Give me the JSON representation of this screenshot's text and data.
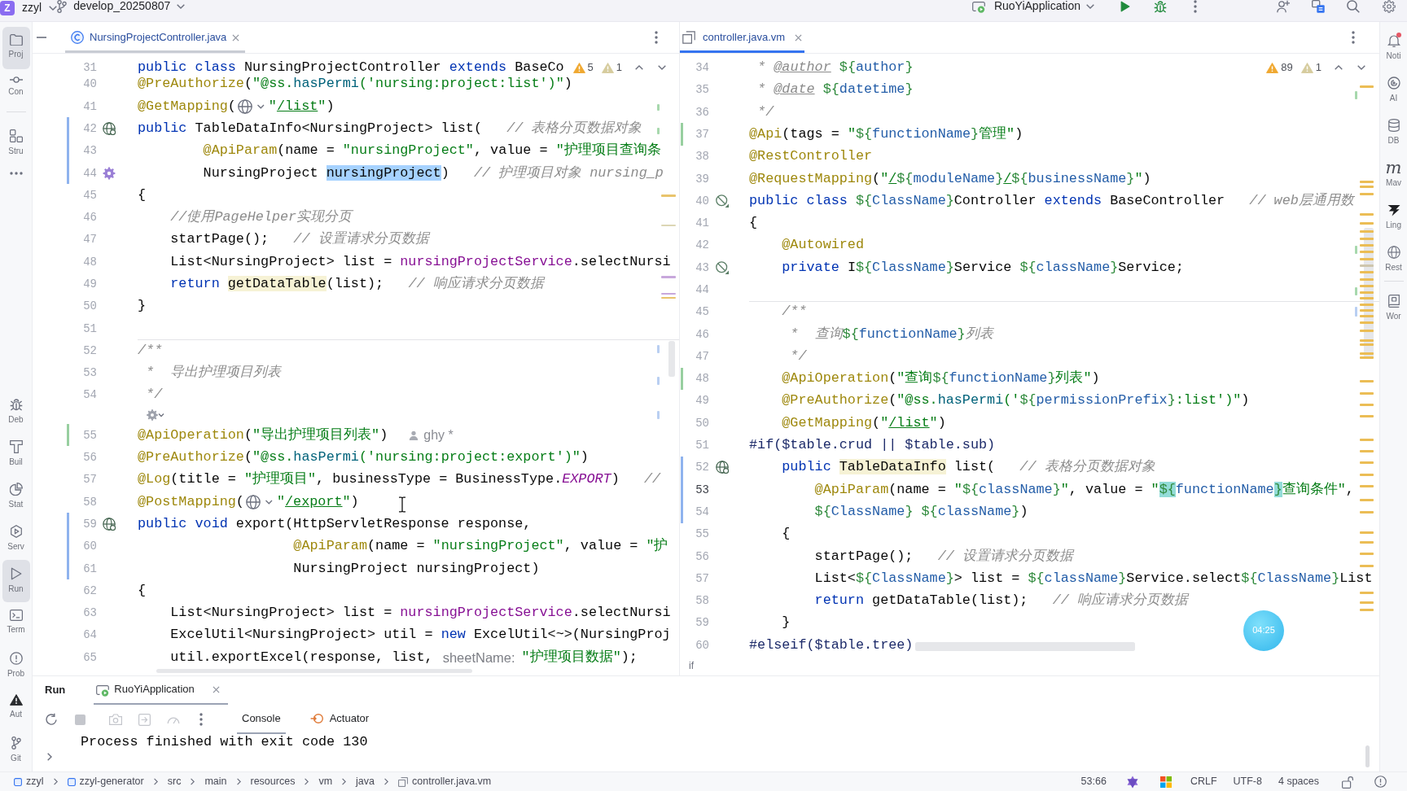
{
  "top_bar": {
    "project": {
      "initial": "Z",
      "name": "zzyl"
    },
    "branch": "develop_20250807",
    "run_configuration": "RuoYiApplication"
  },
  "left_toolbar": {
    "top_groups": [
      [
        {
          "kind": "project",
          "label": "Proj",
          "selected": true
        },
        {
          "kind": "commit",
          "label": "Con",
          "selected": false
        }
      ],
      [
        {
          "kind": "structure",
          "label": "Stru",
          "selected": false
        },
        {
          "kind": "more",
          "selected": false
        }
      ]
    ],
    "bottom": [
      {
        "kind": "debug",
        "label": "Deb",
        "selected": false
      },
      {
        "kind": "build",
        "label": "Buil",
        "selected": false
      },
      {
        "kind": "statistic",
        "label": "Stat",
        "selected": false
      },
      {
        "kind": "services",
        "label": "Serv",
        "selected": false
      },
      {
        "kind": "run",
        "label": "Run",
        "selected": true
      },
      {
        "kind": "terminal",
        "label": "Term",
        "selected": false
      },
      {
        "kind": "problems",
        "label": "Prob",
        "selected": false
      },
      {
        "kind": "alerts",
        "label": "Aut",
        "selected": false
      },
      {
        "kind": "git",
        "label": "Git",
        "selected": false
      }
    ]
  },
  "editors": [
    {
      "tab": {
        "kind": "class",
        "name": "NursingProjectController.java",
        "focused": false
      },
      "inspections": {
        "warnings": "5",
        "weak_warnings": "1"
      },
      "sticky_lines": [
        {
          "number": "31",
          "current": false,
          "tokens": [
            {
              "kind": "keyword",
              "text": "public class "
            },
            {
              "kind": "plain",
              "text": "NursingProjectController "
            },
            {
              "kind": "keyword",
              "text": "extends "
            },
            {
              "kind": "plain",
              "text": "BaseCo"
            }
          ]
        }
      ],
      "lines": [
        {
          "number": "40",
          "current": false,
          "tokens": [
            {
              "kind": "annotation",
              "text": "@PreAuthorize"
            },
            {
              "kind": "plain",
              "text": "("
            },
            {
              "kind": "string",
              "text": "\"@ss."
            },
            {
              "kind": "call",
              "text": "hasPermi"
            },
            {
              "kind": "string",
              "text": "('nursing:project:list')\""
            },
            {
              "kind": "plain",
              "text": ")"
            }
          ]
        },
        {
          "number": "41",
          "current": false,
          "tokens": [
            {
              "kind": "annotation",
              "text": "@GetMapping"
            },
            {
              "kind": "plain",
              "text": "("
            },
            {
              "kind": "endpoint"
            },
            {
              "kind": "string",
              "text": "\""
            },
            {
              "kind": "url",
              "text": "/list"
            },
            {
              "kind": "string",
              "text": "\""
            },
            {
              "kind": "plain",
              "text": ")"
            }
          ]
        },
        {
          "number": "42",
          "current": false,
          "gutter": {
            "kind": "endpoint"
          },
          "change": {
            "kind": "modified"
          },
          "tokens": [
            {
              "kind": "keyword",
              "text": "public "
            },
            {
              "kind": "plain",
              "text": "TableDataInfo<NursingProject> list(   "
            },
            {
              "kind": "comment",
              "text": "// 表格分页数据对象"
            }
          ]
        },
        {
          "number": "43",
          "current": false,
          "change": {
            "kind": "modified"
          },
          "tokens": [
            {
              "kind": "annotation",
              "text": "        @ApiParam"
            },
            {
              "kind": "plain",
              "text": "(name = "
            },
            {
              "kind": "string",
              "text": "\"nursingProject\""
            },
            {
              "kind": "plain",
              "text": ", value = "
            },
            {
              "kind": "string",
              "text": "\"护理项目查询条"
            }
          ]
        },
        {
          "number": "44",
          "current": false,
          "gutter": {
            "kind": "bean"
          },
          "change": {
            "kind": "modified"
          },
          "tokens": [
            {
              "kind": "plain",
              "text": "        NursingProject "
            },
            {
              "kind": "plain",
              "text": "nursingProject",
              "highlight": {
                "kind": "selection"
              }
            },
            {
              "kind": "plain",
              "text": ")   "
            },
            {
              "kind": "comment",
              "text": "// 护理项目对象 nursing_p"
            }
          ]
        },
        {
          "number": "45",
          "current": false,
          "tokens": [
            {
              "kind": "plain",
              "text": "{"
            }
          ]
        },
        {
          "number": "46",
          "current": false,
          "tokens": [
            {
              "kind": "comment",
              "text": "    //使用PageHelper实现分页"
            }
          ]
        },
        {
          "number": "47",
          "current": false,
          "tokens": [
            {
              "kind": "plain",
              "text": "    startPage();   "
            },
            {
              "kind": "comment",
              "text": "// 设置请求分页数据"
            }
          ]
        },
        {
          "number": "48",
          "current": false,
          "tokens": [
            {
              "kind": "plain",
              "text": "    List<NursingProject> list = "
            },
            {
              "kind": "field",
              "text": "nursingProjectService"
            },
            {
              "kind": "plain",
              "text": ".selectNursi"
            }
          ]
        },
        {
          "number": "49",
          "current": false,
          "tokens": [
            {
              "kind": "keyword",
              "text": "    return "
            },
            {
              "kind": "plain",
              "text": "getDataTable",
              "highlight": {
                "kind": "usage"
              }
            },
            {
              "kind": "plain",
              "text": "(list);   "
            },
            {
              "kind": "comment",
              "text": "// 响应请求分页数据"
            }
          ]
        },
        {
          "number": "50",
          "current": false,
          "tokens": [
            {
              "kind": "plain",
              "text": "}"
            }
          ]
        },
        {
          "number": "51",
          "current": false
        },
        {
          "number": "52",
          "current": false,
          "separator": true,
          "tokens": [
            {
              "kind": "comment",
              "text": "/**"
            }
          ]
        },
        {
          "number": "53",
          "current": false,
          "tokens": [
            {
              "kind": "comment",
              "text": " *  导出护理项目列表"
            }
          ]
        },
        {
          "number": "54",
          "current": false,
          "tokens": [
            {
              "kind": "comment",
              "text": " */"
            }
          ]
        },
        {
          "number": "55",
          "current": false,
          "change": {
            "kind": "added"
          },
          "code_vision_above": true,
          "tokens": [
            {
              "kind": "annotation",
              "text": "@ApiOperation"
            },
            {
              "kind": "plain",
              "text": "("
            },
            {
              "kind": "string",
              "text": "\"导出护理项目列表\""
            },
            {
              "kind": "plain",
              "text": ")"
            },
            {
              "kind": "author",
              "text": "ghy *"
            }
          ]
        },
        {
          "number": "56",
          "current": false,
          "tokens": [
            {
              "kind": "annotation",
              "text": "@PreAuthorize"
            },
            {
              "kind": "plain",
              "text": "("
            },
            {
              "kind": "string",
              "text": "\"@ss."
            },
            {
              "kind": "call",
              "text": "hasPermi"
            },
            {
              "kind": "string",
              "text": "('nursing:project:export')\""
            },
            {
              "kind": "plain",
              "text": ")"
            }
          ]
        },
        {
          "number": "57",
          "current": false,
          "tokens": [
            {
              "kind": "annotation",
              "text": "@Log"
            },
            {
              "kind": "plain",
              "text": "(title = "
            },
            {
              "kind": "string",
              "text": "\"护理项目\""
            },
            {
              "kind": "plain",
              "text": ", businessType = BusinessType."
            },
            {
              "kind": "constant",
              "text": "EXPORT"
            },
            {
              "kind": "plain",
              "text": ")   "
            },
            {
              "kind": "comment",
              "text": "//"
            }
          ]
        },
        {
          "number": "58",
          "current": false,
          "tokens": [
            {
              "kind": "annotation",
              "text": "@PostMapping"
            },
            {
              "kind": "plain",
              "text": "("
            },
            {
              "kind": "endpoint"
            },
            {
              "kind": "string",
              "text": "\""
            },
            {
              "kind": "url",
              "text": "/export"
            },
            {
              "kind": "string",
              "text": "\""
            },
            {
              "kind": "plain",
              "text": ")"
            }
          ]
        },
        {
          "number": "59",
          "current": false,
          "gutter": {
            "kind": "endpoint"
          },
          "change": {
            "kind": "modified"
          },
          "tokens": [
            {
              "kind": "keyword",
              "text": "public void "
            },
            {
              "kind": "plain",
              "text": "export(HttpServletResponse response,"
            }
          ]
        },
        {
          "number": "60",
          "current": false,
          "change": {
            "kind": "modified"
          },
          "tokens": [
            {
              "kind": "annotation",
              "text": "                   @ApiParam"
            },
            {
              "kind": "plain",
              "text": "(name = "
            },
            {
              "kind": "string",
              "text": "\"nursingProject\""
            },
            {
              "kind": "plain",
              "text": ", value = "
            },
            {
              "kind": "string",
              "text": "\"护"
            }
          ]
        },
        {
          "number": "61",
          "current": false,
          "change": {
            "kind": "modified"
          },
          "tokens": [
            {
              "kind": "plain",
              "text": "                   NursingProject nursingProject)"
            }
          ]
        },
        {
          "number": "62",
          "current": false,
          "tokens": [
            {
              "kind": "plain",
              "text": "{"
            }
          ]
        },
        {
          "number": "63",
          "current": false,
          "tokens": [
            {
              "kind": "plain",
              "text": "    List<NursingProject> list = "
            },
            {
              "kind": "field",
              "text": "nursingProjectService"
            },
            {
              "kind": "plain",
              "text": ".selectNursi"
            }
          ]
        },
        {
          "number": "64",
          "current": false,
          "tokens": [
            {
              "kind": "plain",
              "text": "    ExcelUtil<NursingProject> util = "
            },
            {
              "kind": "keyword",
              "text": "new "
            },
            {
              "kind": "plain",
              "text": "ExcelUtil<~>(NursingProj"
            }
          ]
        },
        {
          "number": "65",
          "current": false,
          "tokens": [
            {
              "kind": "plain",
              "text": "    util.exportExcel(response, list, "
            },
            {
              "kind": "hint",
              "text": "sheetName:"
            },
            {
              "kind": "string",
              "text": "\"护理项目数据\""
            },
            {
              "kind": "plain",
              "text": ");"
            }
          ]
        }
      ]
    },
    {
      "tab": {
        "kind": "template",
        "name": "controller.java.vm",
        "focused": true
      },
      "inspections": {
        "warnings": "89",
        "weak_warnings": "1"
      },
      "lines": [
        {
          "number": "34",
          "current": false,
          "tokens": [
            {
              "kind": "comment",
              "text": " * "
            },
            {
              "kind": "doctag",
              "text": "@author"
            },
            {
              "kind": "vardelim",
              "text": " ${"
            },
            {
              "kind": "varname",
              "text": "author"
            },
            {
              "kind": "vardelim",
              "text": "}"
            }
          ]
        },
        {
          "number": "35",
          "current": false,
          "tokens": [
            {
              "kind": "comment",
              "text": " * "
            },
            {
              "kind": "doctag",
              "text": "@date"
            },
            {
              "kind": "vardelim",
              "text": " ${"
            },
            {
              "kind": "varname",
              "text": "datetime"
            },
            {
              "kind": "vardelim",
              "text": "}"
            }
          ]
        },
        {
          "number": "36",
          "current": false,
          "tokens": [
            {
              "kind": "comment",
              "text": " */"
            }
          ]
        },
        {
          "number": "37",
          "current": false,
          "change": {
            "kind": "added"
          },
          "tokens": [
            {
              "kind": "annotation",
              "text": "@Api"
            },
            {
              "kind": "plain",
              "text": "(tags = "
            },
            {
              "kind": "string",
              "text": "\""
            },
            {
              "kind": "vardelim",
              "text": "${"
            },
            {
              "kind": "varname",
              "text": "functionName"
            },
            {
              "kind": "vardelim",
              "text": "}"
            },
            {
              "kind": "string",
              "text": "管理\""
            },
            {
              "kind": "plain",
              "text": ")"
            }
          ]
        },
        {
          "number": "38",
          "current": false,
          "tokens": [
            {
              "kind": "annotation",
              "text": "@RestController"
            }
          ]
        },
        {
          "number": "39",
          "current": false,
          "tokens": [
            {
              "kind": "annotation",
              "text": "@RequestMapping"
            },
            {
              "kind": "plain",
              "text": "("
            },
            {
              "kind": "string",
              "text": "\""
            },
            {
              "kind": "url",
              "text": "/"
            },
            {
              "kind": "vardelim",
              "text": "${"
            },
            {
              "kind": "varname",
              "text": "moduleName"
            },
            {
              "kind": "vardelim",
              "text": "}"
            },
            {
              "kind": "url",
              "text": "/"
            },
            {
              "kind": "vardelim",
              "text": "${"
            },
            {
              "kind": "varname",
              "text": "businessName"
            },
            {
              "kind": "vardelim",
              "text": "}"
            },
            {
              "kind": "string",
              "text": "\""
            },
            {
              "kind": "plain",
              "text": ")"
            }
          ]
        },
        {
          "number": "40",
          "current": false,
          "gutter": {
            "kind": "blocked"
          },
          "tokens": [
            {
              "kind": "keyword",
              "text": "public class "
            },
            {
              "kind": "vardelim",
              "text": "${"
            },
            {
              "kind": "varname",
              "text": "ClassName"
            },
            {
              "kind": "vardelim",
              "text": "}"
            },
            {
              "kind": "plain",
              "text": "Controller "
            },
            {
              "kind": "keyword",
              "text": "extends "
            },
            {
              "kind": "plain",
              "text": "BaseController   "
            },
            {
              "kind": "comment",
              "text": "// web层通用数"
            }
          ]
        },
        {
          "number": "41",
          "current": false,
          "tokens": [
            {
              "kind": "plain",
              "text": "{"
            }
          ]
        },
        {
          "number": "42",
          "current": false,
          "tokens": [
            {
              "kind": "annotation",
              "text": "    @Autowired"
            }
          ]
        },
        {
          "number": "43",
          "current": false,
          "gutter": {
            "kind": "blocked"
          },
          "tokens": [
            {
              "kind": "keyword",
              "text": "    private "
            },
            {
              "kind": "plain",
              "text": "I"
            },
            {
              "kind": "vardelim",
              "text": "${"
            },
            {
              "kind": "varname",
              "text": "ClassName"
            },
            {
              "kind": "vardelim",
              "text": "}"
            },
            {
              "kind": "plain",
              "text": "Service "
            },
            {
              "kind": "vardelim",
              "text": "${"
            },
            {
              "kind": "varname",
              "text": "className"
            },
            {
              "kind": "vardelim",
              "text": "}"
            },
            {
              "kind": "plain",
              "text": "Service;"
            }
          ]
        },
        {
          "number": "44",
          "current": false
        },
        {
          "number": "45",
          "current": false,
          "separator": true,
          "tokens": [
            {
              "kind": "comment",
              "text": "    /**"
            }
          ]
        },
        {
          "number": "46",
          "current": false,
          "tokens": [
            {
              "kind": "comment",
              "text": "     *  查询"
            },
            {
              "kind": "vardelim",
              "text": "${"
            },
            {
              "kind": "varname",
              "text": "functionName"
            },
            {
              "kind": "vardelim",
              "text": "}"
            },
            {
              "kind": "comment",
              "text": "列表"
            }
          ]
        },
        {
          "number": "47",
          "current": false,
          "tokens": [
            {
              "kind": "comment",
              "text": "     */"
            }
          ]
        },
        {
          "number": "48",
          "current": false,
          "change": {
            "kind": "added"
          },
          "tokens": [
            {
              "kind": "annotation",
              "text": "    @ApiOperation"
            },
            {
              "kind": "plain",
              "text": "("
            },
            {
              "kind": "string",
              "text": "\"查询"
            },
            {
              "kind": "vardelim",
              "text": "${"
            },
            {
              "kind": "varname",
              "text": "functionName"
            },
            {
              "kind": "vardelim",
              "text": "}"
            },
            {
              "kind": "string",
              "text": "列表\""
            },
            {
              "kind": "plain",
              "text": ")"
            }
          ]
        },
        {
          "number": "49",
          "current": false,
          "tokens": [
            {
              "kind": "annotation",
              "text": "    @PreAuthorize"
            },
            {
              "kind": "plain",
              "text": "("
            },
            {
              "kind": "string",
              "text": "\"@ss."
            },
            {
              "kind": "call",
              "text": "hasPermi"
            },
            {
              "kind": "string",
              "text": "('"
            },
            {
              "kind": "vardelim",
              "text": "${"
            },
            {
              "kind": "varname",
              "text": "permissionPrefix"
            },
            {
              "kind": "vardelim",
              "text": "}"
            },
            {
              "kind": "string",
              "text": ":list')\""
            },
            {
              "kind": "plain",
              "text": ")"
            }
          ]
        },
        {
          "number": "50",
          "current": false,
          "tokens": [
            {
              "kind": "annotation",
              "text": "    @GetMapping"
            },
            {
              "kind": "plain",
              "text": "("
            },
            {
              "kind": "string",
              "text": "\""
            },
            {
              "kind": "url",
              "text": "/list"
            },
            {
              "kind": "string",
              "text": "\""
            },
            {
              "kind": "plain",
              "text": ")"
            }
          ]
        },
        {
          "number": "51",
          "current": false,
          "tokens": [
            {
              "kind": "directive",
              "text": "#if($table.crud || $table.sub)"
            }
          ]
        },
        {
          "number": "52",
          "current": false,
          "gutter": {
            "kind": "endpoint"
          },
          "change": {
            "kind": "modified"
          },
          "tokens": [
            {
              "kind": "keyword",
              "text": "    public "
            },
            {
              "kind": "plain",
              "text": "TableDataInfo",
              "highlight": {
                "kind": "usage"
              }
            },
            {
              "kind": "plain",
              "text": " list(   "
            },
            {
              "kind": "comment",
              "text": "// 表格分页数据对象"
            }
          ]
        },
        {
          "number": "53",
          "current": true,
          "change": {
            "kind": "modified"
          },
          "tokens": [
            {
              "kind": "annotation",
              "text": "        @ApiParam"
            },
            {
              "kind": "plain",
              "text": "(name = "
            },
            {
              "kind": "string",
              "text": "\""
            },
            {
              "kind": "vardelim",
              "text": "${"
            },
            {
              "kind": "varname",
              "text": "className"
            },
            {
              "kind": "vardelim",
              "text": "}"
            },
            {
              "kind": "string",
              "text": "\""
            },
            {
              "kind": "plain",
              "text": ", value = "
            },
            {
              "kind": "string",
              "text": "\""
            },
            {
              "kind": "vardelim",
              "text": "${",
              "highlight": {
                "kind": "brace"
              }
            },
            {
              "kind": "varname",
              "text": "functionName"
            },
            {
              "kind": "vardelim",
              "text": "}",
              "highlight": {
                "kind": "brace"
              }
            },
            {
              "kind": "string",
              "text": "查询条件\""
            },
            {
              "kind": "plain",
              "text": ","
            }
          ]
        },
        {
          "number": "54",
          "current": false,
          "change": {
            "kind": "modified"
          },
          "tokens": [
            {
              "kind": "vardelim",
              "text": "        ${"
            },
            {
              "kind": "varname",
              "text": "ClassName"
            },
            {
              "kind": "vardelim",
              "text": "}"
            },
            {
              "kind": "vardelim",
              "text": " ${"
            },
            {
              "kind": "varname",
              "text": "className"
            },
            {
              "kind": "vardelim",
              "text": "}"
            },
            {
              "kind": "plain",
              "text": ")"
            }
          ]
        },
        {
          "number": "55",
          "current": false,
          "tokens": [
            {
              "kind": "plain",
              "text": "    {"
            }
          ]
        },
        {
          "number": "56",
          "current": false,
          "tokens": [
            {
              "kind": "plain",
              "text": "        startPage();   "
            },
            {
              "kind": "comment",
              "text": "// 设置请求分页数据"
            }
          ]
        },
        {
          "number": "57",
          "current": false,
          "tokens": [
            {
              "kind": "plain",
              "text": "        List<"
            },
            {
              "kind": "vardelim",
              "text": "${"
            },
            {
              "kind": "varname",
              "text": "ClassName"
            },
            {
              "kind": "vardelim",
              "text": "}"
            },
            {
              "kind": "plain",
              "text": "> list = "
            },
            {
              "kind": "vardelim",
              "text": "${"
            },
            {
              "kind": "varname",
              "text": "className"
            },
            {
              "kind": "vardelim",
              "text": "}"
            },
            {
              "kind": "plain",
              "text": "Service.select"
            },
            {
              "kind": "vardelim",
              "text": "${"
            },
            {
              "kind": "varname",
              "text": "ClassName"
            },
            {
              "kind": "vardelim",
              "text": "}"
            },
            {
              "kind": "plain",
              "text": "List"
            }
          ]
        },
        {
          "number": "58",
          "current": false,
          "tokens": [
            {
              "kind": "keyword",
              "text": "        return "
            },
            {
              "kind": "plain",
              "text": "getDataTable(list);   "
            },
            {
              "kind": "comment",
              "text": "// 响应请求分页数据"
            }
          ]
        },
        {
          "number": "59",
          "current": false,
          "tokens": [
            {
              "kind": "plain",
              "text": "    }"
            }
          ]
        },
        {
          "number": "60",
          "current": false,
          "tokens": [
            {
              "kind": "directive",
              "text": "#elseif($table.tree)"
            }
          ]
        }
      ],
      "breadcrumbs": [
        "if"
      ]
    }
  ],
  "right_toolbar": {
    "groups": [
      [
        {
          "kind": "notifications",
          "label": "Noti",
          "unread": true,
          "selected": false
        },
        {
          "kind": "ai",
          "label": "AI",
          "unread": false,
          "selected": false
        },
        {
          "kind": "database",
          "label": "DB",
          "unread": false,
          "selected": false
        },
        {
          "kind": "maven",
          "glyph": "m",
          "label": "Mav",
          "unread": false,
          "selected": false
        },
        {
          "kind": "plugin",
          "label": "Ling",
          "unread": false,
          "selected": false
        },
        {
          "kind": "rest",
          "label": "Rest",
          "unread": false,
          "selected": false
        }
      ],
      [
        {
          "kind": "dictionary",
          "label": "Wor",
          "unread": false,
          "selected": false
        }
      ]
    ]
  },
  "run_panel": {
    "title": "Run",
    "tabs": [
      {
        "label": "RuoYiApplication",
        "selected": true
      }
    ],
    "toolbar": [
      {
        "kind": "rerun",
        "disabled": false
      },
      {
        "kind": "stop",
        "disabled": true
      },
      {
        "kind": "screenshot",
        "disabled": true
      },
      {
        "kind": "export",
        "disabled": true
      },
      {
        "kind": "profile",
        "disabled": true
      },
      {
        "kind": "more",
        "disabled": false
      }
    ],
    "views": [
      {
        "kind": "console",
        "label": "Console",
        "selected": true
      },
      {
        "kind": "actuator",
        "label": "Actuator",
        "selected": false
      }
    ],
    "output": [
      "Process finished with exit code 130"
    ]
  },
  "status_bar": {
    "breadcrumbs": [
      {
        "kind": "module",
        "label": "zzyl"
      },
      {
        "kind": "module",
        "label": "zzyl-generator"
      },
      {
        "kind": "folder",
        "label": "src"
      },
      {
        "kind": "folder",
        "label": "main"
      },
      {
        "kind": "folder",
        "label": "resources"
      },
      {
        "kind": "folder",
        "label": "vm"
      },
      {
        "kind": "folder",
        "label": "java"
      },
      {
        "kind": "template",
        "label": "controller.java.vm"
      }
    ],
    "caret_position": "53:66",
    "line_separator": "CRLF",
    "encoding": "UTF-8",
    "indent": "4 spaces"
  },
  "recording_timer": "04:25"
}
